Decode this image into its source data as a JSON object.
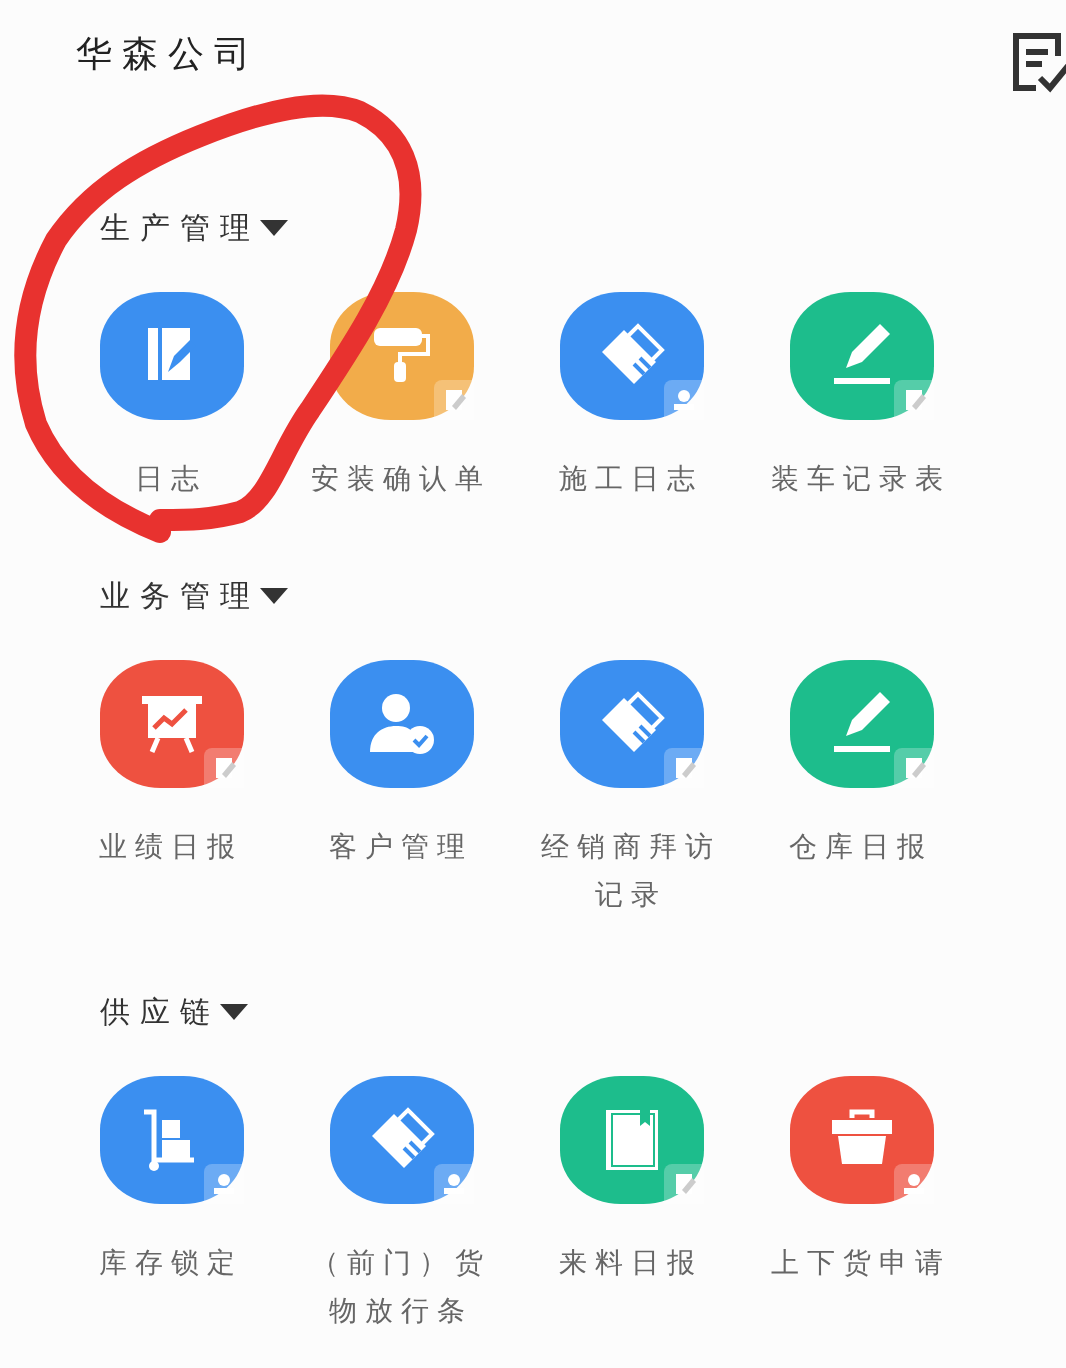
{
  "header": {
    "title": "华森公司"
  },
  "annotation": {
    "kind": "freehand-circle"
  },
  "sections": [
    {
      "title": "生产管理",
      "expanded": true,
      "items": [
        {
          "label": "日志",
          "color": "#3b8ff0",
          "kind": "notebook"
        },
        {
          "label": "安装确认单",
          "color": "#f2ac4a",
          "kind": "roller",
          "badge": {
            "kind": "note"
          }
        },
        {
          "label": "施工日志",
          "color": "#3b8ff0",
          "kind": "handshake",
          "badge": {
            "kind": "stamp"
          }
        },
        {
          "label": "装车记录表",
          "color": "#1dbd8c",
          "kind": "pen",
          "badge": {
            "kind": "note"
          }
        }
      ]
    },
    {
      "title": "业务管理",
      "expanded": true,
      "items": [
        {
          "label": "业绩日报",
          "color": "#ee5140",
          "kind": "chart-board",
          "badge": {
            "kind": "note"
          }
        },
        {
          "label": "客户管理",
          "color": "#3b8ff0",
          "kind": "person-check"
        },
        {
          "label": "经销商拜访记录",
          "color": "#3b8ff0",
          "kind": "handshake",
          "badge": {
            "kind": "note"
          }
        },
        {
          "label": "仓库日报",
          "color": "#1dbd8c",
          "kind": "pen",
          "badge": {
            "kind": "note"
          }
        }
      ]
    },
    {
      "title": "供应链",
      "expanded": true,
      "items": [
        {
          "label": "库存锁定",
          "color": "#3b8ff0",
          "kind": "cart",
          "badge": {
            "kind": "stamp"
          }
        },
        {
          "label": "（前门）货物放行条",
          "color": "#3b8ff0",
          "kind": "handshake",
          "badge": {
            "kind": "stamp"
          }
        },
        {
          "label": "来料日报",
          "color": "#1dbd8c",
          "kind": "book",
          "badge": {
            "kind": "note"
          }
        },
        {
          "label": "上下货申请",
          "color": "#ee5140",
          "kind": "toolbox",
          "badge": {
            "kind": "stamp"
          }
        }
      ]
    }
  ]
}
